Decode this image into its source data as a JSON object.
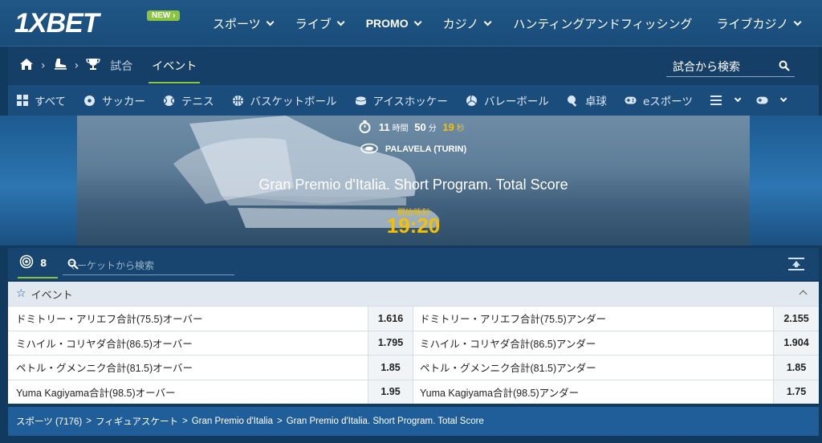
{
  "header": {
    "logo": "1XBET",
    "new_badge": "NEW",
    "nav": [
      "スポーツ",
      "ライブ",
      "PROMO",
      "カジノ",
      "ハンティングアンドフィッシング",
      "ライブカジノ"
    ]
  },
  "breadcrumb": {
    "items": [
      "試合",
      "イベント"
    ],
    "search_placeholder": "試合から検索"
  },
  "sports": {
    "items": [
      "すべて",
      "サッカー",
      "テニス",
      "バスケットボール",
      "アイスホッケー",
      "バレーボール",
      "卓球",
      "eスポーツ"
    ]
  },
  "banner": {
    "hours": "11",
    "hours_unit": "時間",
    "minutes": "50",
    "minutes_unit": "分",
    "seconds": "19",
    "seconds_unit": "秒",
    "venue": "PALAVELA (TURIN)",
    "title": "Gran Premio d'Italia. Short Program. Total Score",
    "start_label": "開始時刻",
    "start_time": "19:20"
  },
  "market": {
    "count": "8",
    "search_placeholder": "マーケットから検索"
  },
  "events": {
    "header": "イベント",
    "rows": [
      {
        "name1": "ドミトリー・アリエフ合計(75.5)オーバー",
        "odd1": "1.616",
        "name2": "ドミトリー・アリエフ合計(75.5)アンダー",
        "odd2": "2.155"
      },
      {
        "name1": "ミハイル・コリヤダ合計(86.5)オーバー",
        "odd1": "1.795",
        "name2": "ミハイル・コリヤダ合計(86.5)アンダー",
        "odd2": "1.904"
      },
      {
        "name1": "ペトル・グメンニク合計(81.5)オーバー",
        "odd1": "1.85",
        "name2": "ペトル・グメンニク合計(81.5)アンダー",
        "odd2": "1.85"
      },
      {
        "name1": "Yuma Kagiyama合計(98.5)オーバー",
        "odd1": "1.95",
        "name2": "Yuma Kagiyama合計(98.5)アンダー",
        "odd2": "1.75"
      }
    ]
  },
  "footer": {
    "crumbs": [
      "スポーツ (7176)",
      "フィギュアスケート",
      "Gran Premio d'Italia",
      "Gran Premio d'Italia. Short Program. Total Score"
    ]
  },
  "colors": {
    "header_bg": "#1a4c79",
    "accent_green": "#8bc53f",
    "timer_yellow": "#f4c000",
    "footer_bg": "#1f5e98"
  }
}
